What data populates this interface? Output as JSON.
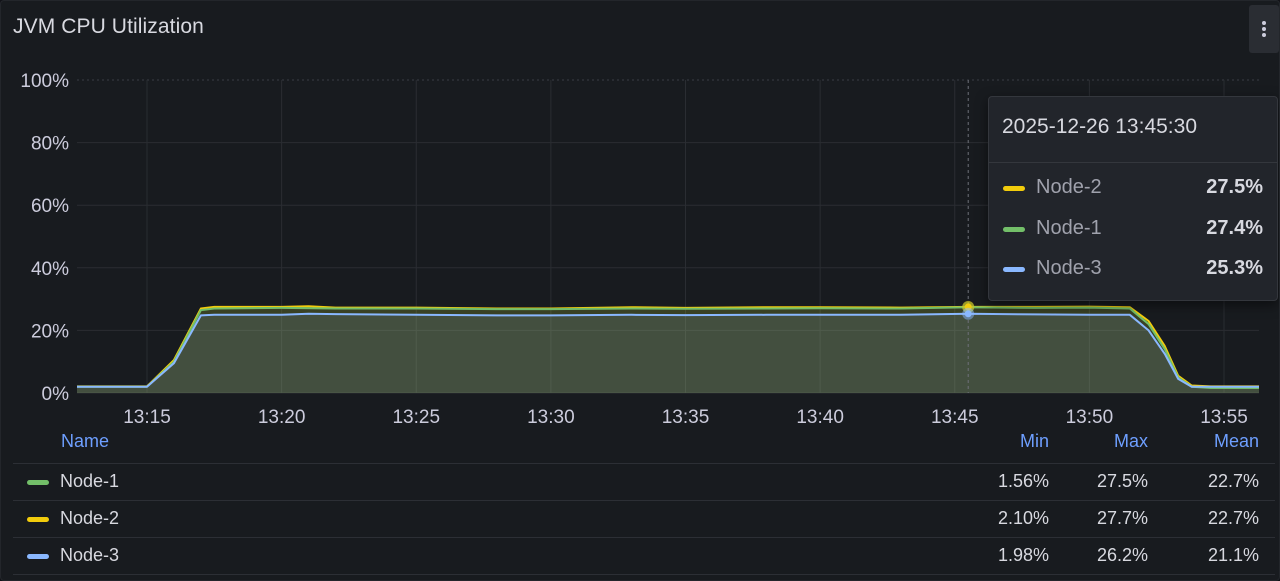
{
  "panel": {
    "title": "JVM CPU Utilization",
    "menu_icon": "more-vertical-icon"
  },
  "chart_data": {
    "type": "area",
    "y_ticks": [
      "0%",
      "20%",
      "40%",
      "60%",
      "80%",
      "100%"
    ],
    "ylim": [
      0,
      100
    ],
    "x_ticks": [
      "13:15",
      "13:20",
      "13:25",
      "13:30",
      "13:35",
      "13:40",
      "13:45",
      "13:50",
      "13:55"
    ],
    "x_range_minutes": [
      12.4,
      56.3
    ],
    "series": [
      {
        "name": "Node-1",
        "color": "#73bf69",
        "points": [
          [
            12.4,
            2.0
          ],
          [
            15.0,
            2.0
          ],
          [
            16.0,
            10
          ],
          [
            17.0,
            26.5
          ],
          [
            17.5,
            27.0
          ],
          [
            20,
            27.2
          ],
          [
            22,
            27.0
          ],
          [
            25,
            27.0
          ],
          [
            28,
            26.8
          ],
          [
            30,
            26.8
          ],
          [
            33,
            27.0
          ],
          [
            35,
            26.9
          ],
          [
            38,
            27.0
          ],
          [
            40,
            27.1
          ],
          [
            43,
            27.0
          ],
          [
            45.5,
            27.4
          ],
          [
            48,
            27.2
          ],
          [
            50,
            27.3
          ],
          [
            51.5,
            27.0
          ],
          [
            52.2,
            22.0
          ],
          [
            52.8,
            14.0
          ],
          [
            53.3,
            5.0
          ],
          [
            53.8,
            2.0
          ],
          [
            54.5,
            1.6
          ],
          [
            56.3,
            1.6
          ]
        ]
      },
      {
        "name": "Node-2",
        "color": "#f2cc0c",
        "points": [
          [
            12.4,
            2.1
          ],
          [
            15.0,
            2.1
          ],
          [
            16.0,
            10.5
          ],
          [
            17.0,
            27.0
          ],
          [
            17.5,
            27.5
          ],
          [
            20,
            27.5
          ],
          [
            21,
            27.7
          ],
          [
            22,
            27.3
          ],
          [
            25,
            27.3
          ],
          [
            28,
            27.0
          ],
          [
            30,
            27.0
          ],
          [
            33,
            27.4
          ],
          [
            35,
            27.2
          ],
          [
            38,
            27.4
          ],
          [
            40,
            27.4
          ],
          [
            43,
            27.3
          ],
          [
            45.5,
            27.5
          ],
          [
            48,
            27.5
          ],
          [
            50,
            27.6
          ],
          [
            51.5,
            27.4
          ],
          [
            52.2,
            23.0
          ],
          [
            52.8,
            15.0
          ],
          [
            53.3,
            5.5
          ],
          [
            53.8,
            2.4
          ],
          [
            54.5,
            2.1
          ],
          [
            56.3,
            2.1
          ]
        ]
      },
      {
        "name": "Node-3",
        "color": "#8ab8ff",
        "points": [
          [
            12.4,
            2.0
          ],
          [
            15.0,
            2.0
          ],
          [
            16.0,
            9.5
          ],
          [
            17.0,
            24.8
          ],
          [
            17.5,
            25.0
          ],
          [
            20,
            25.0
          ],
          [
            21,
            25.3
          ],
          [
            22,
            25.2
          ],
          [
            25,
            25.0
          ],
          [
            28,
            24.8
          ],
          [
            30,
            24.8
          ],
          [
            33,
            25.0
          ],
          [
            35,
            24.9
          ],
          [
            38,
            25.0
          ],
          [
            40,
            25.0
          ],
          [
            43,
            25.0
          ],
          [
            45.5,
            25.3
          ],
          [
            48,
            25.1
          ],
          [
            50,
            25.0
          ],
          [
            51.5,
            25.0
          ],
          [
            52.2,
            20.0
          ],
          [
            52.8,
            12.5
          ],
          [
            53.3,
            4.5
          ],
          [
            53.8,
            2.0
          ],
          [
            54.5,
            2.0
          ],
          [
            56.3,
            2.0
          ]
        ]
      }
    ],
    "hover_x_minute": 45.5,
    "grid": true
  },
  "tooltip": {
    "time": "2025-12-26 13:45:30",
    "rows": [
      {
        "name": "Node-2",
        "value": "27.5%",
        "color": "#f2cc0c"
      },
      {
        "name": "Node-1",
        "value": "27.4%",
        "color": "#73bf69"
      },
      {
        "name": "Node-3",
        "value": "25.3%",
        "color": "#8ab8ff"
      }
    ]
  },
  "legend": {
    "headers": {
      "name": "Name",
      "min": "Min",
      "max": "Max",
      "mean": "Mean"
    },
    "rows": [
      {
        "name": "Node-1",
        "color": "#73bf69",
        "min": "1.56%",
        "max": "27.5%",
        "mean": "22.7%"
      },
      {
        "name": "Node-2",
        "color": "#f2cc0c",
        "min": "2.10%",
        "max": "27.7%",
        "mean": "22.7%"
      },
      {
        "name": "Node-3",
        "color": "#8ab8ff",
        "min": "1.98%",
        "max": "26.2%",
        "mean": "21.1%"
      }
    ]
  }
}
